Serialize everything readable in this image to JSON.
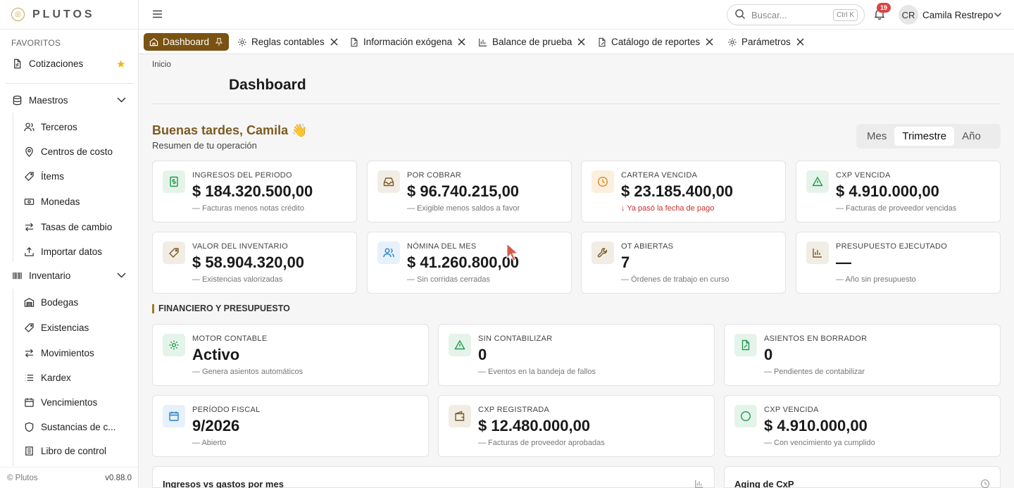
{
  "app": {
    "logo_text": "PLUTOS",
    "version": "v0.88.0",
    "footer_copy": "© Plutos"
  },
  "sidebar": {
    "favorites_title": "FAVORITOS",
    "favorites": [
      {
        "label": "Cotizaciones",
        "icon": "file-icon"
      }
    ],
    "groups": [
      {
        "label": "Maestros",
        "icon": "database-icon",
        "items": [
          {
            "label": "Terceros",
            "icon": "users-icon"
          },
          {
            "label": "Centros de costo",
            "icon": "map-pin-icon"
          },
          {
            "label": "Ítems",
            "icon": "tag-icon"
          },
          {
            "label": "Monedas",
            "icon": "banknote-icon"
          },
          {
            "label": "Tasas de cambio",
            "icon": "arrows-icon"
          },
          {
            "label": "Importar datos",
            "icon": "upload-icon"
          }
        ]
      },
      {
        "label": "Inventario",
        "icon": "barcode-icon",
        "items": [
          {
            "label": "Bodegas",
            "icon": "warehouse-icon"
          },
          {
            "label": "Existencias",
            "icon": "tag-icon"
          },
          {
            "label": "Movimientos",
            "icon": "arrows-icon"
          },
          {
            "label": "Kardex",
            "icon": "list-icon"
          },
          {
            "label": "Vencimientos",
            "icon": "calendar-icon"
          },
          {
            "label": "Sustancias de c...",
            "icon": "shield-icon"
          },
          {
            "label": "Libro de control",
            "icon": "book-icon"
          }
        ]
      }
    ]
  },
  "topbar": {
    "search_placeholder": "Buscar...",
    "search_shortcut": "Ctrl K",
    "notifications_count": "19",
    "user_initials": "CR",
    "user_name": "Camila Restrepo"
  },
  "tabs": [
    {
      "label": "Dashboard",
      "icon": "home-icon",
      "active": true
    },
    {
      "label": "Reglas contables",
      "icon": "gear-icon"
    },
    {
      "label": "Información exógena",
      "icon": "file-edit-icon"
    },
    {
      "label": "Balance de prueba",
      "icon": "bar-chart-icon"
    },
    {
      "label": "Catálogo de reportes",
      "icon": "file-edit-icon"
    },
    {
      "label": "Parámetros",
      "icon": "gear-icon"
    }
  ],
  "page": {
    "breadcrumb": "Inicio",
    "title": "Dashboard",
    "greeting": "Buenas tardes, Camila 👋",
    "greeting_sub": "Resumen de tu operación",
    "periods": [
      "Mes",
      "Trimestre",
      "Año"
    ],
    "selected_period": "Trimestre"
  },
  "kpis": [
    {
      "label": "INGRESOS DEL PERIODO",
      "value": "$ 184.320.500,00",
      "sub": "— Facturas menos notas crédito",
      "icon": "dollar-icon",
      "tone": "green"
    },
    {
      "label": "POR COBRAR",
      "value": "$ 96.740.215,00",
      "sub": "— Exigible menos saldos a favor",
      "icon": "inbox-icon",
      "tone": "tan"
    },
    {
      "label": "CARTERA VENCIDA",
      "value": "$ 23.185.400,00",
      "sub": "Ya pasó la fecha de pago",
      "icon": "clock-icon",
      "tone": "orange",
      "alert": true
    },
    {
      "label": "CXP VENCIDA",
      "value": "$ 4.910.000,00",
      "sub": "— Facturas de proveedor vencidas",
      "icon": "warning-icon",
      "tone": "green"
    },
    {
      "label": "VALOR DEL INVENTARIO",
      "value": "$ 58.904.320,00",
      "sub": "— Existencias valorizadas",
      "icon": "tag-icon",
      "tone": "tan"
    },
    {
      "label": "NÓMINA DEL MES",
      "value": "$ 41.260.800,00",
      "sub": "— Sin corridas cerradas",
      "icon": "users-icon",
      "tone": "blue"
    },
    {
      "label": "OT ABIERTAS",
      "value": "7",
      "sub": "— Órdenes de trabajo en curso",
      "icon": "wrench-icon",
      "tone": "tan"
    },
    {
      "label": "PRESUPUESTO EJECUTADO",
      "value": "—",
      "sub": "— Año sin presupuesto",
      "icon": "bar-chart-icon",
      "tone": "tan"
    }
  ],
  "finance_section": {
    "title": "FINANCIERO Y PRESUPUESTO",
    "cards": [
      {
        "label": "MOTOR CONTABLE",
        "value": "Activo",
        "sub": "— Genera asientos automáticos",
        "icon": "gear-icon",
        "tone": "green"
      },
      {
        "label": "SIN CONTABILIZAR",
        "value": "0",
        "sub": "— Eventos en la bandeja de fallos",
        "icon": "warning-icon",
        "tone": "green"
      },
      {
        "label": "ASIENTOS EN BORRADOR",
        "value": "0",
        "sub": "— Pendientes de contabilizar",
        "icon": "file-edit-icon",
        "tone": "green"
      },
      {
        "label": "PERÍODO FISCAL",
        "value": "9/2026",
        "sub": "— Abierto",
        "icon": "calendar-icon",
        "tone": "blue"
      },
      {
        "label": "CXP REGISTRADA",
        "value": "$ 12.480.000,00",
        "sub": "— Facturas de proveedor aprobadas",
        "icon": "wallet-icon",
        "tone": "tan"
      },
      {
        "label": "CXP VENCIDA",
        "value": "$ 4.910.000,00",
        "sub": "— Con vencimiento ya cumplido",
        "icon": "circle-icon",
        "tone": "green"
      }
    ]
  },
  "panels": [
    {
      "title": "Ingresos vs gastos por mes",
      "icon": "bar-chart-icon"
    },
    {
      "title": "Aging de CxP",
      "icon": "clock-icon"
    }
  ],
  "colors": {
    "accent": "#7a5212",
    "greeting": "#7b5a21",
    "alert": "#cf2d2d",
    "star": "#f3b21b"
  }
}
